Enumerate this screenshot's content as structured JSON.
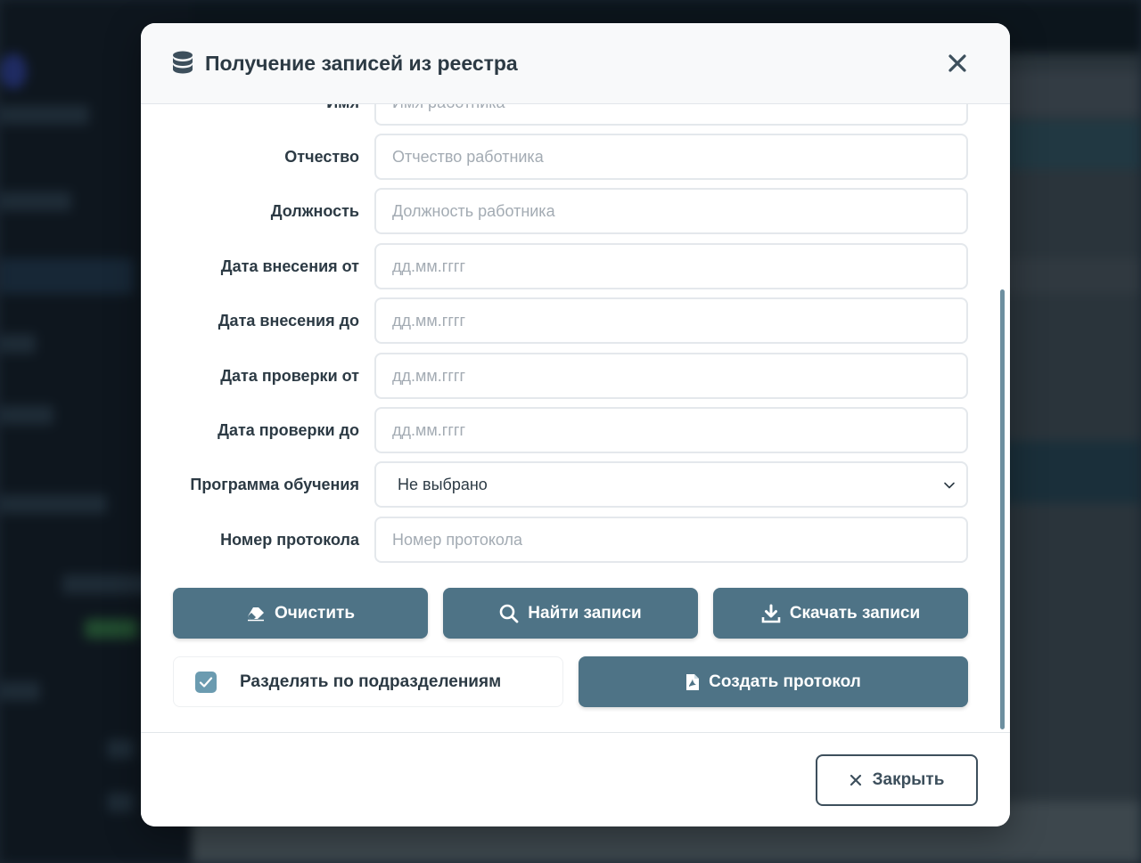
{
  "modal": {
    "title": "Получение записей из реестра",
    "icon": "database-icon"
  },
  "form": {
    "fields": [
      {
        "label": "Имя",
        "placeholder": "Имя работника",
        "value": ""
      },
      {
        "label": "Отчество",
        "placeholder": "Отчество работника",
        "value": ""
      },
      {
        "label": "Должность",
        "placeholder": "Должность работника",
        "value": ""
      },
      {
        "label": "Дата внесения от",
        "placeholder": "дд.мм.гггг",
        "value": ""
      },
      {
        "label": "Дата внесения до",
        "placeholder": "дд.мм.гггг",
        "value": ""
      },
      {
        "label": "Дата проверки от",
        "placeholder": "дд.мм.гггг",
        "value": ""
      },
      {
        "label": "Дата проверки до",
        "placeholder": "дд.мм.гггг",
        "value": ""
      }
    ],
    "program": {
      "label": "Программа обучения",
      "selected": "Не выбрано"
    },
    "protocol": {
      "label": "Номер протокола",
      "placeholder": "Номер протокола",
      "value": ""
    }
  },
  "actions": {
    "clear": "Очистить",
    "find": "Найти записи",
    "download": "Скачать записи",
    "split_label": "Разделять по подразделениям",
    "split_checked": true,
    "create_protocol": "Создать протокол"
  },
  "footer": {
    "close": "Закрыть"
  },
  "colors": {
    "primary_button": "#4e7386",
    "checkbox": "#6b9bb0",
    "text": "#2c3a44",
    "placeholder": "#a3abb3"
  }
}
